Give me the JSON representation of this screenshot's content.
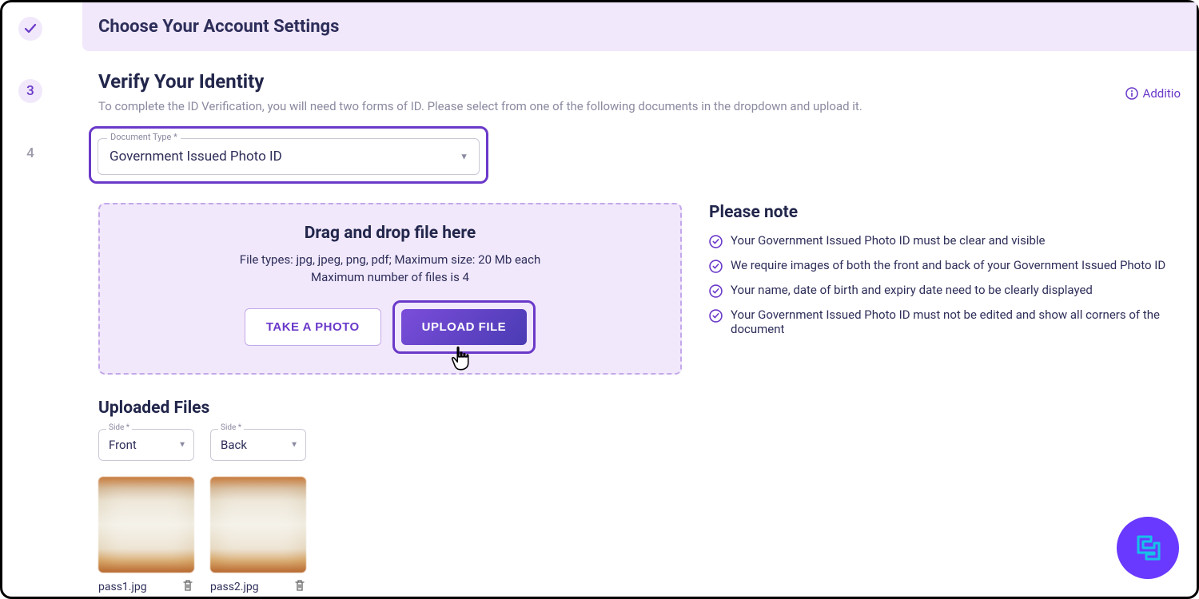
{
  "steps": {
    "three": "3",
    "four": "4"
  },
  "banner": {
    "title": "Choose Your Account Settings"
  },
  "identity": {
    "title": "Verify Your Identity",
    "subtitle": "To complete the ID Verification, you will need two forms of ID. Please select from one of the following documents in the dropdown and upload it.",
    "additional_hint": "Additio",
    "doc_type_label": "Document Type *",
    "doc_type_value": "Government Issued Photo ID"
  },
  "dropzone": {
    "title": "Drag and drop file here",
    "types": "File types: jpg, jpeg, png, pdf; Maximum size: 20 Mb each",
    "limit": "Maximum number of files is 4",
    "take_photo": "TAKE A PHOTO",
    "upload": "UPLOAD FILE"
  },
  "notes": {
    "title": "Please note",
    "items": [
      "Your Government Issued Photo ID must be clear and visible",
      "We require images of both the front and back of your Government Issued Photo ID",
      "Your name, date of birth and expiry date need to be clearly displayed",
      "Your Government Issued Photo ID must not be edited and show all corners of the document"
    ]
  },
  "uploaded": {
    "title": "Uploaded Files",
    "side_label": "Side *",
    "sides": [
      "Front",
      "Back"
    ],
    "files": [
      {
        "name": "pass1.jpg"
      },
      {
        "name": "pass2.jpg"
      }
    ]
  }
}
